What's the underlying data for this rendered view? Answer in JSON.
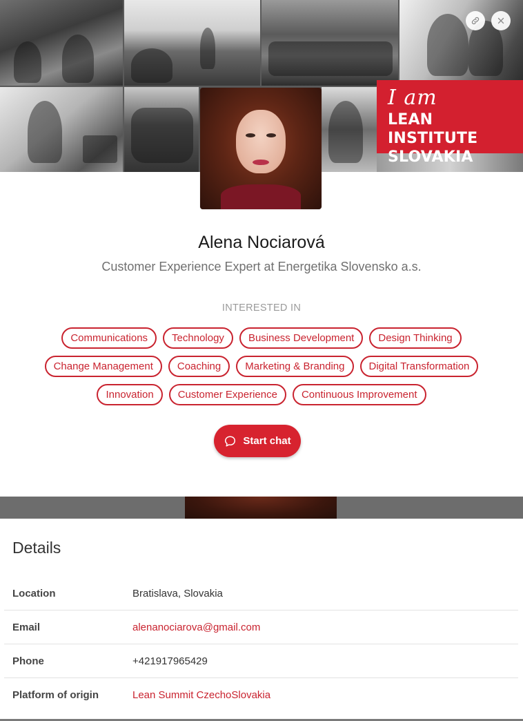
{
  "cover": {
    "brand_script": "I am",
    "brand_line1": "LEAN INSTITUTE",
    "brand_line2": "SLOVAKIA"
  },
  "profile": {
    "name": "Alena Nociarová",
    "headline": "Customer Experience Expert at Energetika Slovensko a.s.",
    "interested_label": "INTERESTED IN",
    "interests": [
      "Communications",
      "Technology",
      "Business Development",
      "Design Thinking",
      "Change Management",
      "Coaching",
      "Marketing & Branding",
      "Digital Transformation",
      "Innovation",
      "Customer Experience",
      "Continuous Improvement"
    ],
    "chat_label": "Start chat"
  },
  "details": {
    "title": "Details",
    "rows": [
      {
        "key": "Location",
        "value": "Bratislava, Slovakia"
      },
      {
        "key": "Email",
        "value": "alenanociarova@gmail.com"
      },
      {
        "key": "Phone",
        "value": "+421917965429"
      },
      {
        "key": "Platform of origin",
        "value": "Lean Summit CzechoSlovakia"
      }
    ]
  },
  "colors": {
    "accent": "#c9232f",
    "brand_red": "#d3202f"
  },
  "icons": {
    "copy_link": "link-icon",
    "close": "close-icon",
    "chat": "chat-bubble-icon"
  }
}
